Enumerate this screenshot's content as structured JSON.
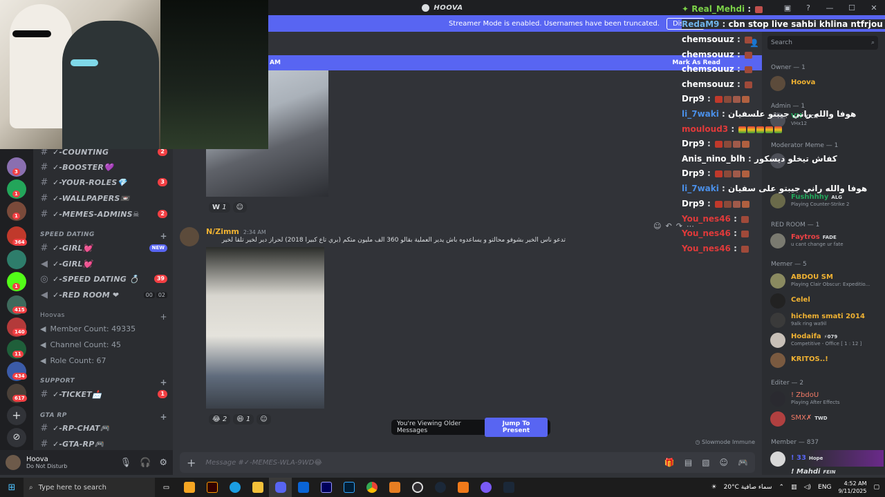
{
  "app": {
    "title": "HOOVA",
    "colors": {
      "accent": "#5865f2",
      "bg": "#313338",
      "sidebar": "#2b2d31",
      "dark": "#1e1f22",
      "danger": "#f23f43"
    }
  },
  "banner": {
    "text": "Streamer Mode is enabled. Usernames have been truncated.",
    "button": "Disable"
  },
  "unread": {
    "suffix": "AM",
    "mark_read": "Mark As Read"
  },
  "guilds": {
    "badges": [
      "3",
      "1",
      "1",
      "364",
      "1",
      "415",
      "140",
      "11",
      "434",
      "617"
    ]
  },
  "channels": {
    "top": [
      {
        "name": "✓-COUNTING",
        "badge": "2"
      },
      {
        "name": "✓-BOOSTER💜",
        "badge": ""
      },
      {
        "name": "✓-YOUR-ROLES💎",
        "badge": "3"
      },
      {
        "name": "✓-WALLPAPERS📼",
        "badge": ""
      },
      {
        "name": "✓-MEMES-ADMINS☠",
        "badge": "2"
      }
    ],
    "speed_dating": {
      "label": "SPEED DATING",
      "items": [
        {
          "name": "✓-GIRL💓",
          "badge": "NEW"
        },
        {
          "name": "✓-GIRL💓",
          "badge": ""
        },
        {
          "name": "✓-SPEED DATING 💍",
          "badge": "39"
        },
        {
          "name": "✓-RED ROOM ❤",
          "vc1": "00",
          "vc2": "02"
        }
      ]
    },
    "hoovas": {
      "label": "Hoovas",
      "stats": [
        "Member Count: 49335",
        "Channel Count: 45",
        "Role Count: 67"
      ]
    },
    "support": {
      "label": "SUPPORT",
      "items": [
        {
          "name": "✓-TICKET📩",
          "badge": "1"
        }
      ]
    },
    "gta": {
      "label": "GTA RP",
      "items": [
        {
          "name": "✓-RP-CHAT🎮"
        },
        {
          "name": "✓-GTA-RP🎮"
        }
      ]
    }
  },
  "user": {
    "name": "Hoova",
    "status": "Do Not Disturb"
  },
  "messages": {
    "first_reactions": [
      {
        "emoji": "W",
        "count": "1"
      }
    ],
    "msg": {
      "author": "N/Zimm",
      "time": "2:34 AM",
      "text": "تدعو ناس الخير بشوفو محالتو و يساعدوه باش يدير العملية بقالو 360 ألف مليون متكم (بري تاع كبيرا 2018) لحراز دير لخير تلقا لخير"
    },
    "reactions": [
      {
        "emoji": "😂",
        "count": "2"
      },
      {
        "emoji": "😆",
        "count": "1"
      }
    ],
    "older_text": "You're Viewing Older Messages",
    "jump": "Jump To Present",
    "slowmode": "Slowmode Immune"
  },
  "composer": {
    "placeholder": "Message #✓-MEMES-WLA-9WD😂"
  },
  "members": {
    "search_placeholder": "Search",
    "groups": [
      {
        "header": "Owner — 1",
        "items": [
          {
            "name": "Hoova",
            "color": "#f0b232",
            "status": ""
          }
        ]
      },
      {
        "header": "Admin — 1",
        "items": [
          {
            "name": "VH",
            "color": "#23a55a",
            "status": "VHx12",
            "tag": "KICK"
          }
        ]
      },
      {
        "header": "Moderator Meme — 1",
        "items": [
          {
            "name": "",
            "color": "#dbdee1",
            "status": ""
          }
        ]
      },
      {
        "header": "",
        "items": [
          {
            "name": "Fushhhhy",
            "color": "#23a55a",
            "status": "Playing Counter-Strike 2",
            "tag": "ALG"
          }
        ]
      },
      {
        "header": "RED ROOM — 1",
        "items": [
          {
            "name": "Faytros",
            "color": "#ed4245",
            "status": "u cant change ur fate",
            "tag": "FADE"
          }
        ]
      },
      {
        "header": "Memer — 5",
        "items": [
          {
            "name": "ABDOU SM",
            "color": "#f0b232",
            "status": "Playing Clair Obscur: Expeditio..."
          },
          {
            "name": "Celel",
            "color": "#f0b232",
            "status": ""
          },
          {
            "name": "hichem smati 2014",
            "color": "#f0b232",
            "status": "9alk ring wa9il"
          },
          {
            "name": "Hodaifa",
            "color": "#f0b232",
            "status": "Competitive - Office [ 1 : 12 ]",
            "tag": "⚡079"
          },
          {
            "name": "KRITOS..!",
            "color": "#f0b232",
            "status": ""
          }
        ]
      },
      {
        "header": "Editer — 2",
        "items": [
          {
            "name": "! ZbdoU",
            "color": "#f47b67",
            "status": "Playing After Effects"
          },
          {
            "name": "SMX✗",
            "color": "#f47b67",
            "status": "",
            "tag": "TWD"
          }
        ]
      },
      {
        "header": "Member — 837",
        "items": [
          {
            "name": "! 33",
            "color": "#5865f2",
            "status": "",
            "tag": "Hope"
          },
          {
            "name": "! Mahdi",
            "color": "#dbdee1",
            "status": "",
            "tag": "FEIN"
          }
        ]
      }
    ]
  },
  "chat": [
    {
      "user": "✦ Real_Mehdi",
      "color": "#7bd148",
      "msg": ""
    },
    {
      "user": "RedaM9",
      "color": "#6fb3e8",
      "msg": "cbn stop live sahbi khlina ntfrjou replay"
    },
    {
      "user": "chemsouuz",
      "color": "#ffffff",
      "msg": ""
    },
    {
      "user": "chemsouuz",
      "color": "#ffffff",
      "msg": ""
    },
    {
      "user": "chemsouuz",
      "color": "#ffffff",
      "msg": ""
    },
    {
      "user": "chemsouuz",
      "color": "#ffffff",
      "msg": ""
    },
    {
      "user": "Drp9",
      "color": "#ffffff",
      "msg": ""
    },
    {
      "user": "li_7waki",
      "color": "#4a8fe8",
      "msg": "هوفا والله راني جيبتو علسفيان"
    },
    {
      "user": "mouloud3",
      "color": "#e03a3a",
      "msg": ""
    },
    {
      "user": "Drp9",
      "color": "#ffffff",
      "msg": ""
    },
    {
      "user": "Anis_nino_blh",
      "color": "#ffffff",
      "msg": "كفاش تيخلو ديسكور"
    },
    {
      "user": "Drp9",
      "color": "#ffffff",
      "msg": ""
    },
    {
      "user": "li_7waki",
      "color": "#4a8fe8",
      "msg": "هوفا والله راني جيبتو على سفيان"
    },
    {
      "user": "Drp9",
      "color": "#ffffff",
      "msg": ""
    },
    {
      "user": "You_nes46",
      "color": "#e03a3a",
      "msg": ""
    },
    {
      "user": "You_nes46",
      "color": "#e03a3a",
      "msg": ""
    },
    {
      "user": "You_nes46",
      "color": "#e03a3a",
      "msg": ""
    }
  ],
  "taskbar": {
    "search": "Type here to search",
    "weather": "20°C  سماء صافية",
    "lang": "ENG",
    "time": "4:52 AM",
    "date": "9/11/2025"
  }
}
